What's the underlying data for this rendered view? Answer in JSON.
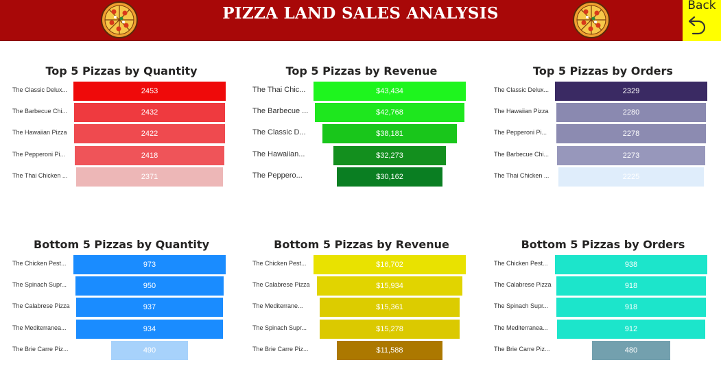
{
  "header": {
    "title": "PIZZA LAND SALES ANALYSIS",
    "back_label": "Back",
    "header_color": "#a80808",
    "back_color": "#ffff00"
  },
  "icons": {
    "left_logo": "pizza-icon",
    "right_logo": "pizza-icon",
    "back": "undo-arrow-icon"
  },
  "chart_data": [
    {
      "type": "funnel",
      "title": "Top 5 Pizzas by Quantity",
      "categories": [
        "The Classic Delux...",
        "The Barbecue Chi...",
        "The Hawaiian Pizza",
        "The Pepperoni Pi...",
        "The Thai Chicken ..."
      ],
      "values": [
        2453,
        2432,
        2422,
        2418,
        2371
      ],
      "labels": [
        "2453",
        "2432",
        "2422",
        "2418",
        "2371"
      ],
      "colors": [
        "#ef0a0a",
        "#ef3a3f",
        "#ef4a4f",
        "#ef5459",
        "#edb7b7"
      ]
    },
    {
      "type": "funnel",
      "title": "Top 5 Pizzas by Revenue",
      "categories": [
        "The Thai Chic...",
        "The Barbecue ...",
        "The Classic D...",
        "The Hawaiian...",
        "The Peppero..."
      ],
      "values": [
        43434,
        42768,
        38181,
        32273,
        30162
      ],
      "labels": [
        "$43,434",
        "$42,768",
        "$38,181",
        "$32,273",
        "$30,162"
      ],
      "colors": [
        "#1ef51e",
        "#1ee71e",
        "#19c61b",
        "#138f1e",
        "#0a7e22"
      ]
    },
    {
      "type": "funnel",
      "title": "Top 5 Pizzas by Orders",
      "categories": [
        "The Classic Delux...",
        "The Hawaiian Pizza",
        "The Pepperoni Pi...",
        "The Barbecue Chi...",
        "The Thai Chicken ..."
      ],
      "values": [
        2329,
        2280,
        2278,
        2273,
        2225
      ],
      "labels": [
        "2329",
        "2280",
        "2278",
        "2273",
        "2225"
      ],
      "colors": [
        "#3a2a63",
        "#8a89b0",
        "#8c8bb1",
        "#9797bb",
        "#dfedfb"
      ]
    },
    {
      "type": "funnel",
      "title": "Bottom 5 Pizzas by Quantity",
      "categories": [
        "The Chicken Pest...",
        "The Spinach Supr...",
        "The Calabrese Pizza",
        "The Mediterranea...",
        "The Brie Carre Piz..."
      ],
      "values": [
        973,
        950,
        937,
        934,
        490
      ],
      "labels": [
        "973",
        "950",
        "937",
        "934",
        "490"
      ],
      "colors": [
        "#1a8cff",
        "#1a8cff",
        "#1a8cff",
        "#1a8cff",
        "#a7d2fb"
      ]
    },
    {
      "type": "funnel",
      "title": "Bottom 5 Pizzas by Revenue",
      "categories": [
        "The Chicken Pest...",
        "The Calabrese Pizza",
        "The Mediterrane...",
        "The Spinach Supr...",
        "The Brie Carre Piz..."
      ],
      "values": [
        16702,
        15934,
        15361,
        15278,
        11588
      ],
      "labels": [
        "$16,702",
        "$15,934",
        "$15,361",
        "$15,278",
        "$11,588"
      ],
      "colors": [
        "#e9e200",
        "#e1d400",
        "#dccc00",
        "#dbc900",
        "#ac7800"
      ]
    },
    {
      "type": "funnel",
      "title": "Bottom 5 Pizzas by Orders",
      "categories": [
        "The Chicken Pest...",
        "The Calabrese Pizza",
        "The Spinach Supr...",
        "The Mediterranea...",
        "The Brie Carre Piz..."
      ],
      "values": [
        938,
        918,
        918,
        912,
        480
      ],
      "labels": [
        "938",
        "918",
        "918",
        "912",
        "480"
      ],
      "colors": [
        "#1ce5cb",
        "#1ce5cb",
        "#1ce5cb",
        "#1ce5cb",
        "#73a0ae"
      ]
    }
  ]
}
